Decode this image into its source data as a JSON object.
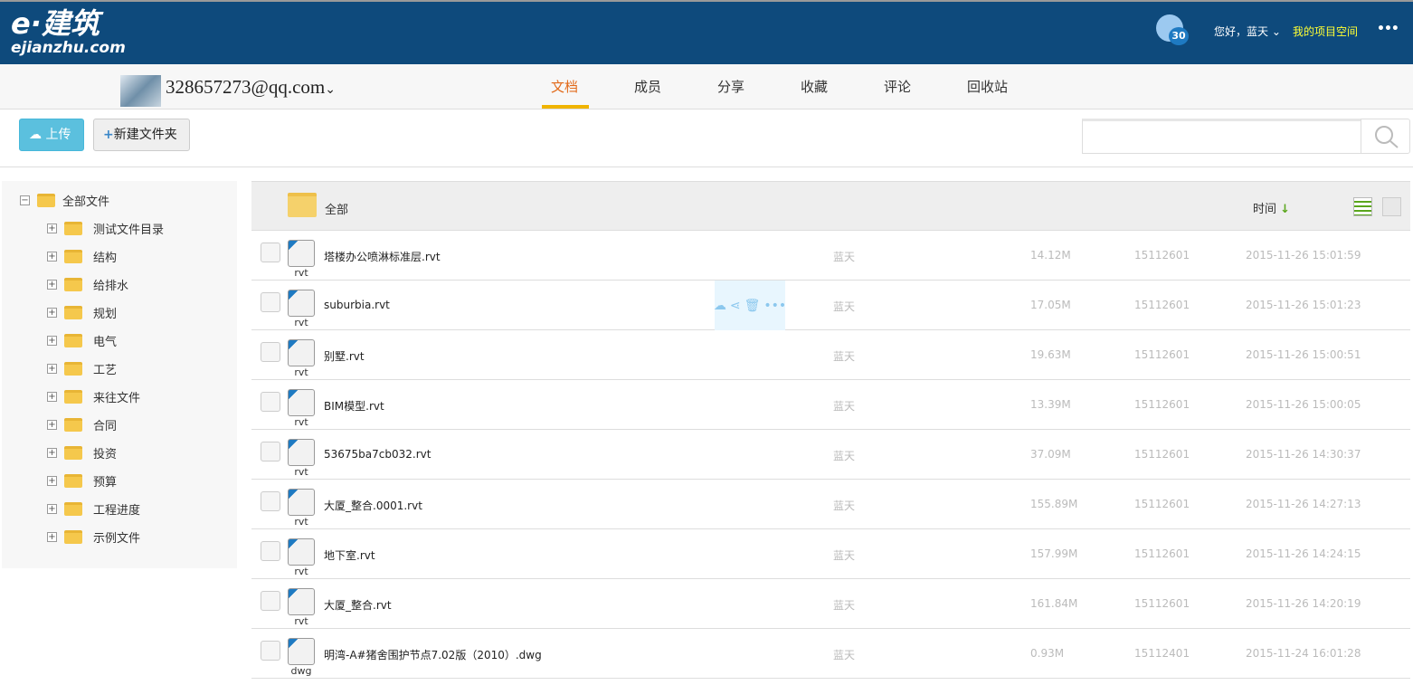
{
  "header": {
    "logo_main": "e·建筑",
    "logo_sub": "ejianzhu.com",
    "notif_count": "30",
    "greeting": "您好，蓝天",
    "my_project": "我的项目空间",
    "more": "•••"
  },
  "nav": {
    "account": "328657273@qq.com",
    "tabs": [
      "文档",
      "成员",
      "分享",
      "收藏",
      "评论",
      "回收站"
    ],
    "active": "文档"
  },
  "toolbar": {
    "upload": "上传",
    "new_folder": "新建文件夹",
    "search_placeholder": ""
  },
  "tree": {
    "root": "全部文件",
    "items": [
      "测试文件目录",
      "结构",
      "给排水",
      "规划",
      "电气",
      "工艺",
      "来往文件",
      "合同",
      "投资",
      "预算",
      "工程进度",
      "示例文件"
    ]
  },
  "list": {
    "folder": "全部",
    "sort_label": "时间",
    "rows": [
      {
        "name": "塔楼办公喷淋标准层.rvt",
        "ext": "rvt",
        "owner": "蓝天",
        "size": "14.12M",
        "id": "15112601",
        "time": "2015-11-26 15:01:59"
      },
      {
        "name": "suburbia.rvt",
        "ext": "rvt",
        "owner": "蓝天",
        "size": "17.05M",
        "id": "15112601",
        "time": "2015-11-26 15:01:23"
      },
      {
        "name": "别墅.rvt",
        "ext": "rvt",
        "owner": "蓝天",
        "size": "19.63M",
        "id": "15112601",
        "time": "2015-11-26 15:00:51"
      },
      {
        "name": "BIM模型.rvt",
        "ext": "rvt",
        "owner": "蓝天",
        "size": "13.39M",
        "id": "15112601",
        "time": "2015-11-26 15:00:05"
      },
      {
        "name": "53675ba7cb032.rvt",
        "ext": "rvt",
        "owner": "蓝天",
        "size": "37.09M",
        "id": "15112601",
        "time": "2015-11-26 14:30:37"
      },
      {
        "name": "大厦_整合.0001.rvt",
        "ext": "rvt",
        "owner": "蓝天",
        "size": "155.89M",
        "id": "15112601",
        "time": "2015-11-26 14:27:13"
      },
      {
        "name": "地下室.rvt",
        "ext": "rvt",
        "owner": "蓝天",
        "size": "157.99M",
        "id": "15112601",
        "time": "2015-11-26 14:24:15"
      },
      {
        "name": "大厦_整合.rvt",
        "ext": "rvt",
        "owner": "蓝天",
        "size": "161.84M",
        "id": "15112601",
        "time": "2015-11-26 14:20:19"
      },
      {
        "name": "明湾-A#猪舍围护节点7.02版（2010）.dwg",
        "ext": "dwg",
        "owner": "蓝天",
        "size": "0.93M",
        "id": "15112401",
        "time": "2015-11-24 16:01:28"
      }
    ]
  }
}
